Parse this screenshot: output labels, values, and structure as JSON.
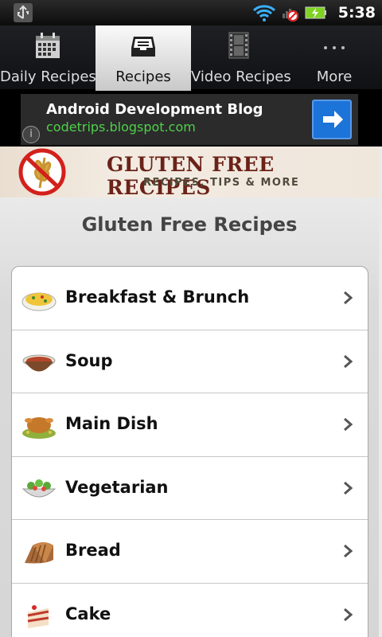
{
  "status_bar": {
    "time": "5:38",
    "icons": [
      "usb-icon",
      "wifi-icon",
      "signal-blocked-icon",
      "battery-charging-icon"
    ]
  },
  "tabs": [
    {
      "label": "Daily Recipes",
      "icon": "calendar-icon",
      "active": false
    },
    {
      "label": "Recipes",
      "icon": "inbox-tray-icon",
      "active": true
    },
    {
      "label": "Video Recipes",
      "icon": "film-strip-icon",
      "active": false
    },
    {
      "label": "More",
      "icon": "more-dots-icon",
      "active": false
    }
  ],
  "ad": {
    "title": "Android Development Blog",
    "url": "codetrips.blogspot.com",
    "info": "i"
  },
  "banner": {
    "title": "GLUTEN FREE RECIPES",
    "subtitle": "RECIPES, TIPS & MORE"
  },
  "page_title": "Gluten Free Recipes",
  "categories": [
    {
      "label": "Breakfast & Brunch",
      "icon": "omelette-icon"
    },
    {
      "label": "Soup",
      "icon": "soup-bowl-icon"
    },
    {
      "label": "Main Dish",
      "icon": "roast-turkey-icon"
    },
    {
      "label": "Vegetarian",
      "icon": "salad-icon"
    },
    {
      "label": "Bread",
      "icon": "bread-loaf-icon"
    },
    {
      "label": "Cake",
      "icon": "cake-slice-icon"
    }
  ],
  "colors": {
    "accent_ad_button": "#1c73d8",
    "ad_url": "#4fd04a",
    "banner_title": "#6b2218"
  }
}
